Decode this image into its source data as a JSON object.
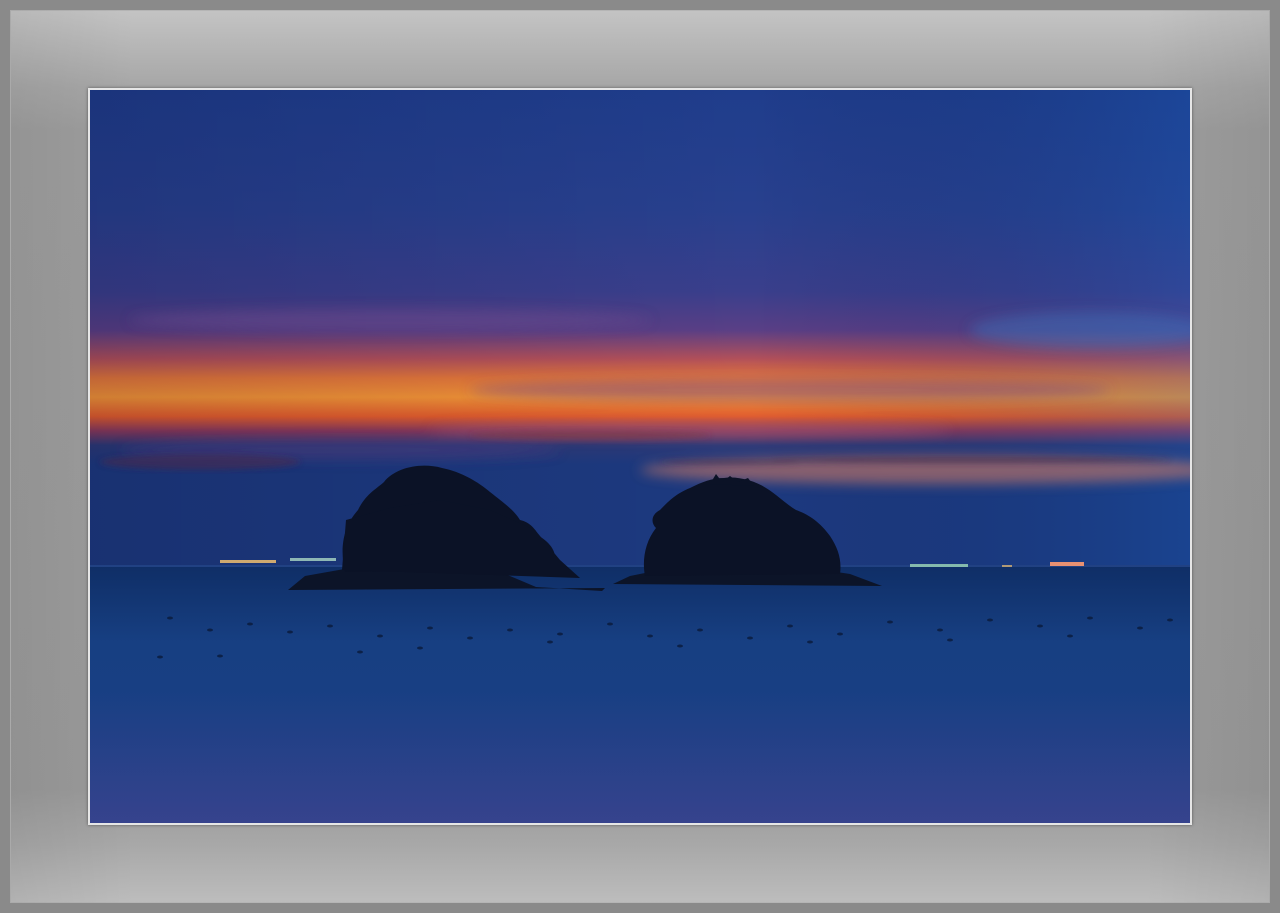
{
  "image": {
    "subject": "photograph",
    "colors": {
      "frame": "#9a9a9a",
      "mat_highlight": "#c4c4c4",
      "photo_border": "#e6e6e6",
      "sky_top": "#1a3f8e",
      "sky_mid": "#3e3f8c",
      "glow_orange": "#f08a2e",
      "glow_red": "#d9442c",
      "sea": "#163a78",
      "silhouette": "#0b1226"
    }
  }
}
